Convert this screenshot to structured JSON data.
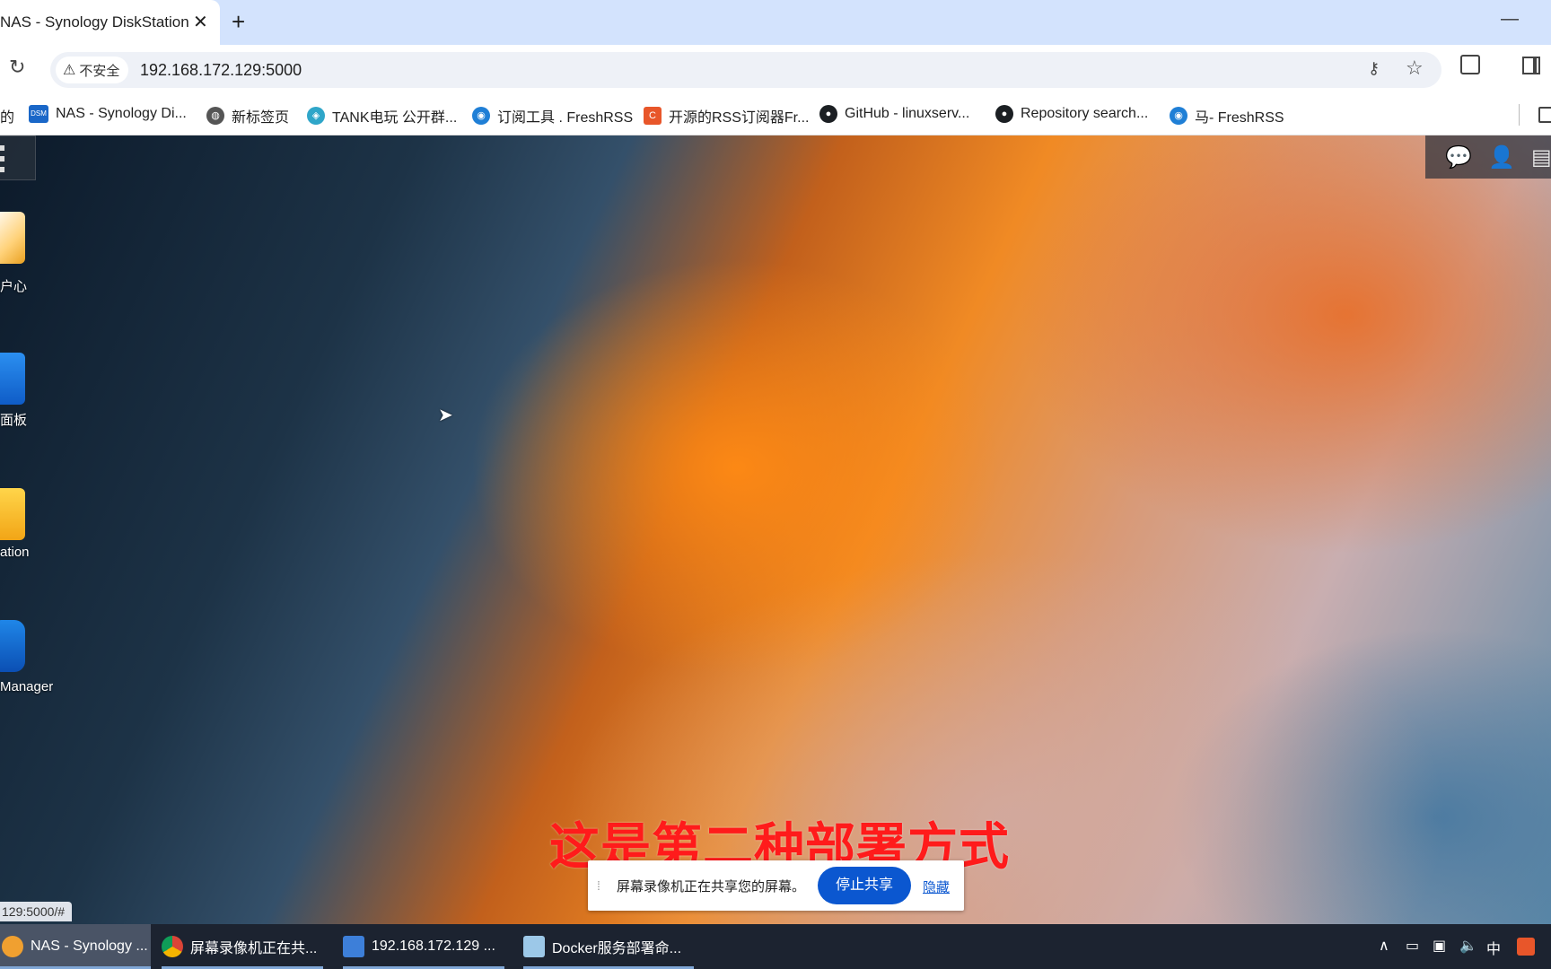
{
  "browser": {
    "tab_title": "NAS - Synology DiskStation",
    "tab_close": "✕",
    "new_tab": "+",
    "minimize": "—",
    "security_label": "不安全",
    "url": "192.168.172.129:5000"
  },
  "bookmarks": {
    "leading_fragment": "的",
    "items": [
      {
        "label": "NAS - Synology Di...",
        "icon": "dsm-icon",
        "color": "#1a67c8",
        "glyph": "DSM"
      },
      {
        "label": "新标签页",
        "icon": "globe-icon",
        "color": "#555555",
        "glyph": "◍"
      },
      {
        "label": "TANK电玩 公开群...",
        "icon": "tank-icon",
        "color": "#2fa6c9",
        "glyph": "◈"
      },
      {
        "label": "订阅工具 . FreshRSS",
        "icon": "freshrss-icon",
        "color": "#1f7fd6",
        "glyph": "◉"
      },
      {
        "label": "开源的RSS订阅器Fr...",
        "icon": "csdn-icon",
        "color": "#e8562a",
        "glyph": "C"
      },
      {
        "label": "GitHub - linuxserv...",
        "icon": "github-icon",
        "color": "#1b1f23",
        "glyph": "●"
      },
      {
        "label": "Repository search...",
        "icon": "github-icon",
        "color": "#1b1f23",
        "glyph": "●"
      },
      {
        "label": "马- FreshRSS",
        "icon": "freshrss-icon",
        "color": "#1f7fd6",
        "glyph": "◉"
      }
    ]
  },
  "desktop": {
    "icons": [
      {
        "label": "户心",
        "icon": "package-center-icon"
      },
      {
        "label": "面板",
        "icon": "control-panel-icon"
      },
      {
        "label": "ation",
        "icon": "file-station-icon"
      },
      {
        "label": "Manager",
        "icon": "container-manager-icon"
      }
    ],
    "caption": "这是第二种部署方式",
    "share_bar": {
      "grip": "⁞",
      "message": "屏幕录像机正在共享您的屏幕。",
      "stop_label": "停止共享",
      "hide_label": "隐藏"
    },
    "status_url": "129:5000/#"
  },
  "taskbar": {
    "items": [
      {
        "label": "NAS - Synology ...",
        "icon": "chrome-icon"
      },
      {
        "label": "屏幕录像机正在共...",
        "icon": "chrome-icon"
      },
      {
        "label": "192.168.172.129 ...",
        "icon": "remote-desktop-icon"
      },
      {
        "label": "Docker服务部署命...",
        "icon": "notepad-icon"
      }
    ],
    "ime": "中",
    "chevron": "∧"
  },
  "colors": {
    "tab_strip": "#d3e3fd",
    "taskbar": "#1c2330",
    "caption": "#ff1b1b",
    "stop_button": "#0b57d0"
  }
}
